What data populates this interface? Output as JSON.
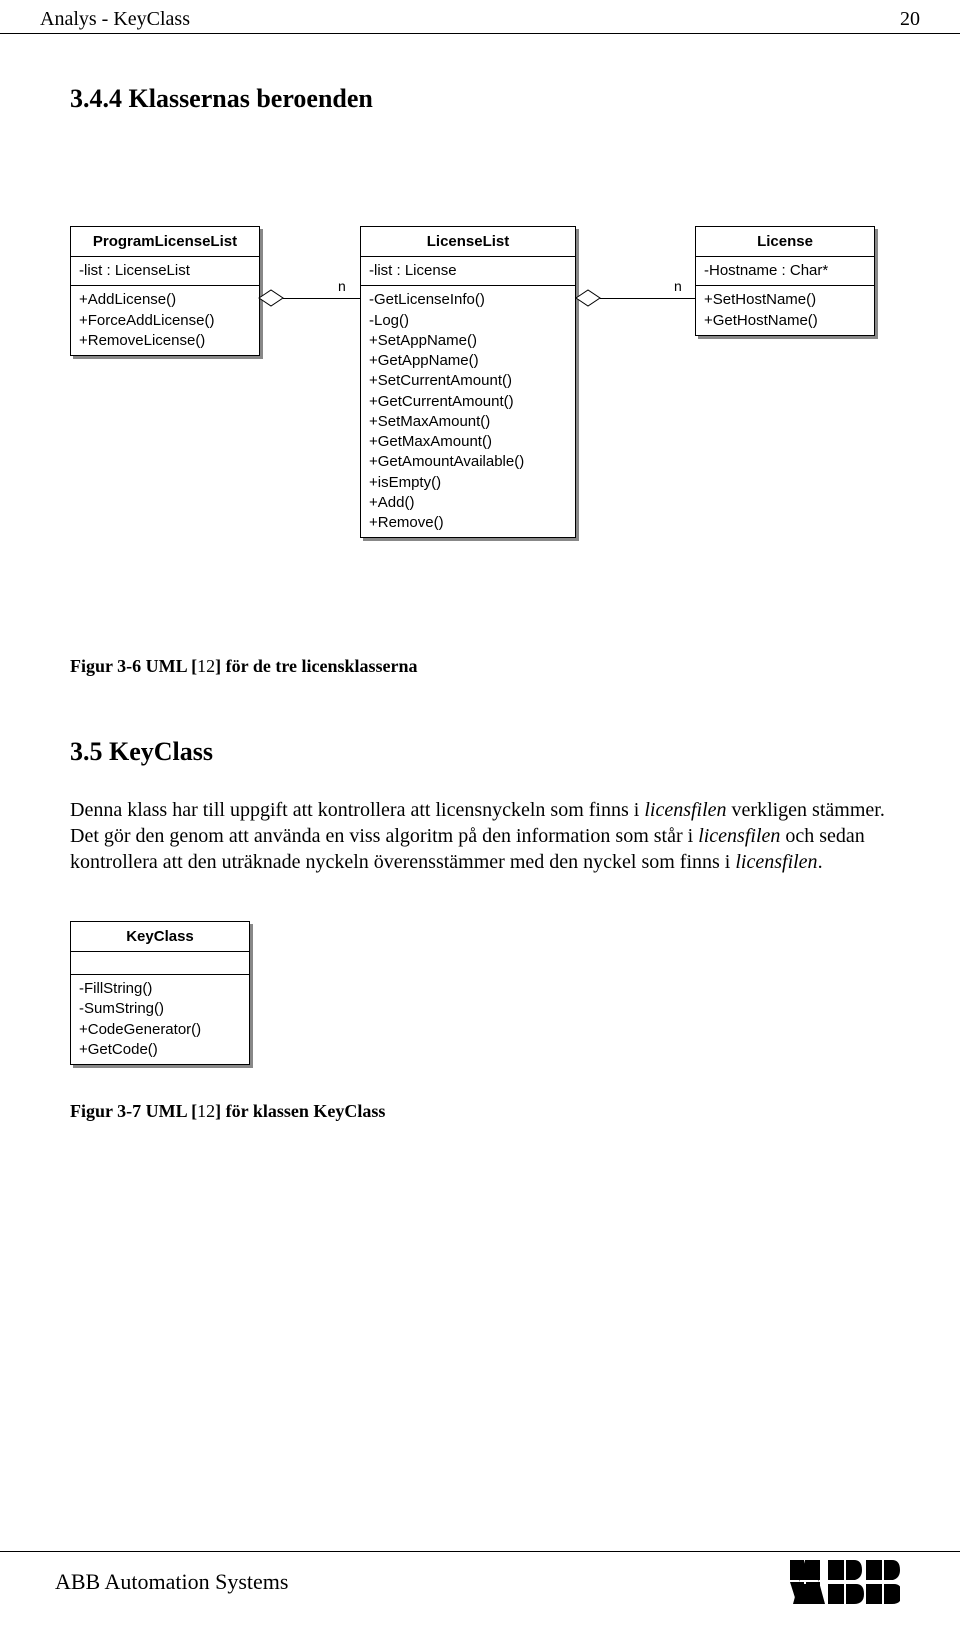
{
  "header": {
    "left": "Analys - KeyClass",
    "right": "20"
  },
  "h1": "3.4.4  Klassernas beroenden",
  "diagram": {
    "conn_n1": "n",
    "conn_n2": "n",
    "box1": {
      "title": "ProgramLicenseList",
      "attrs": [
        "-list : LicenseList"
      ],
      "ops": [
        "+AddLicense()",
        "+ForceAddLicense()",
        "+RemoveLicense()"
      ]
    },
    "box2": {
      "title": "LicenseList",
      "attrs": [
        "-list : License"
      ],
      "ops": [
        "-GetLicenseInfo()",
        "-Log()",
        "+SetAppName()",
        "+GetAppName()",
        "+SetCurrentAmount()",
        "+GetCurrentAmount()",
        "+SetMaxAmount()",
        "+GetMaxAmount()",
        "+GetAmountAvailable()",
        "+isEmpty()",
        "+Add()",
        "+Remove()"
      ]
    },
    "box3": {
      "title": "License",
      "attrs": [
        "-Hostname : Char*"
      ],
      "ops": [
        "+SetHostName()",
        "+GetHostName()"
      ]
    }
  },
  "fig36": {
    "prefix": "Figur 3-6 UML ",
    "ref_open": "[",
    "ref_num": "12",
    "ref_close": "]",
    "suffix": " för de tre licensklasserna"
  },
  "h2": "3.5  KeyClass",
  "para": {
    "t1": "Denna klass har till uppgift att kontrollera att licensnyckeln som finns i ",
    "i1": "licensfilen",
    "t2": " verkligen stämmer. Det gör den genom att använda en viss algoritm på den information som står i ",
    "i2": "licensfilen",
    "t3": " och sedan kontrollera att den uträknade nyckeln överensstämmer med den nyckel som finns i ",
    "i3": "licensfilen",
    "t4": "."
  },
  "diagram2": {
    "title": "KeyClass",
    "ops": [
      "-FillString()",
      "-SumString()",
      "+CodeGenerator()",
      "+GetCode()"
    ]
  },
  "fig37": {
    "prefix": "Figur 3-7 UML ",
    "ref_open": "[",
    "ref_num": "12",
    "ref_close": "]",
    "suffix": " för klassen KeyClass"
  },
  "footer": {
    "text": "ABB Automation Systems"
  }
}
